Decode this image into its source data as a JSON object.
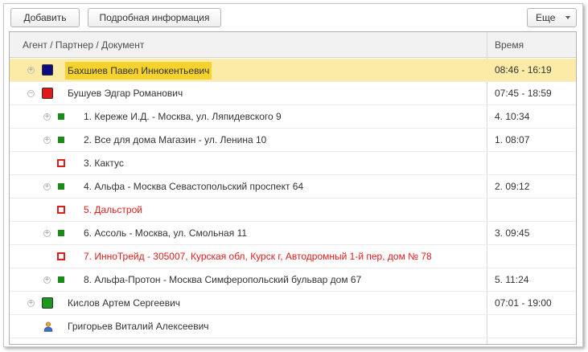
{
  "toolbar": {
    "add_label": "Добавить",
    "details_label": "Подробная информация",
    "more_label": "Еще"
  },
  "table": {
    "columns": [
      "Агент / Партнер / Документ",
      "Время"
    ],
    "rows": [
      {
        "name": "Бахшиев Павел Иннокентьевич",
        "time": "08:46 - 16:19",
        "color": "#0c0c80"
      },
      {
        "name": "Бушуев Эдгар Романович",
        "time": "07:45 - 18:59",
        "color": "#e41a1a"
      },
      {
        "name": "1. Кереже И.Д.  -  Москва, ул. Ляпидевского 9",
        "time": "4. 10:34",
        "color": "#1a8a1a"
      },
      {
        "name": "2. Все для дома Магазин  -  ул. Ленина 10",
        "time": "1. 08:07",
        "color": "#1a8a1a"
      },
      {
        "name": "3. Кактус",
        "time": "",
        "color": "#e01b1b"
      },
      {
        "name": "4. Альфа  -  Москва Севастопольский проспект 64",
        "time": "2. 09:12",
        "color": "#1a8a1a"
      },
      {
        "name": "5. Дальстрой",
        "time": "",
        "color": "#e01b1b"
      },
      {
        "name": "6. Ассоль  -  Москва, ул. Смольная 11",
        "time": "3. 09:45",
        "color": "#1a8a1a"
      },
      {
        "name": "7. ИнноТрейд  -  305007, Курская обл, Курск г, Автодромный 1-й пер, дом № 78",
        "time": "",
        "color": "#e01b1b"
      },
      {
        "name": "8. Альфа-Протон  -  Москва Симферопольский бульвар дом 67",
        "time": "5. 11:24",
        "color": "#1a8a1a"
      },
      {
        "name": "Кислов Артем Сергеевич",
        "time": "07:01 - 19:00",
        "color": "#1a9a1a"
      },
      {
        "name": "Григорьев Виталий Алексеевич",
        "time": "",
        "icon": "person-icon"
      }
    ]
  }
}
